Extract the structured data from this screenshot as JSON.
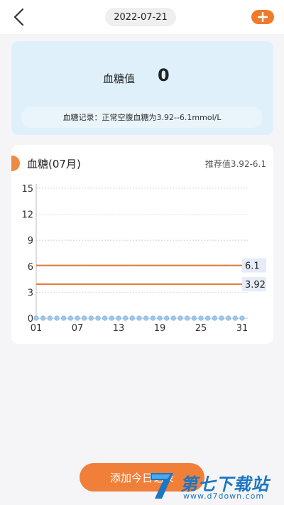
{
  "header": {
    "date": "2022-07-21",
    "back_icon": "chevron-left-icon",
    "add_icon": "plus-icon",
    "accent_color": "#ef7a2a"
  },
  "summary": {
    "label": "血糖值",
    "value": "0",
    "note": "血糖记录：正常空腹血糖为3.92--6.1mmol/L"
  },
  "chart": {
    "title": "血糖(07月)",
    "reference": "推荐值3.92-6.1"
  },
  "chart_data": {
    "type": "line",
    "x_ticks": [
      "01",
      "07",
      "13",
      "19",
      "25",
      "31"
    ],
    "y_ticks": [
      "0",
      "3",
      "6",
      "9",
      "12",
      "15"
    ],
    "ylim": [
      0,
      15
    ],
    "xlim": [
      1,
      31
    ],
    "grid": true,
    "reference_lines": [
      {
        "value": 6.1,
        "label": "6.1",
        "color": "#e07b3c"
      },
      {
        "value": 3.92,
        "label": "3.92",
        "color": "#e07b3c"
      }
    ],
    "series": [
      {
        "color": "#9ec9ee",
        "x": [
          1,
          2,
          3,
          4,
          5,
          6,
          7,
          8,
          9,
          10,
          11,
          12,
          13,
          14,
          15,
          16,
          17,
          18,
          19,
          20,
          21,
          22,
          23,
          24,
          25,
          26,
          27,
          28,
          29,
          30,
          31
        ],
        "values": [
          0,
          0,
          0,
          0,
          0,
          0,
          0,
          0,
          0,
          0,
          0,
          0,
          0,
          0,
          0,
          0,
          0,
          0,
          0,
          0,
          0,
          0,
          0,
          0,
          0,
          0,
          0,
          0,
          0,
          0,
          0
        ]
      }
    ]
  },
  "actions": {
    "add_today_label": "添加今日记录"
  },
  "watermark": {
    "title": "第七下载站",
    "url": "www.d7down.com"
  }
}
